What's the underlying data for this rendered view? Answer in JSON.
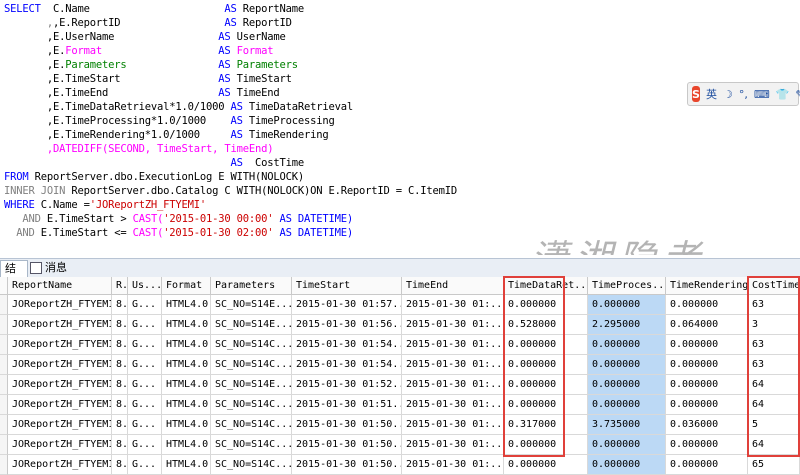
{
  "sql": {
    "l1": {
      "kw": "SELECT",
      "expr": "C.Name",
      "as": "AS",
      "alias": "ReportName"
    },
    "l2": {
      "expr": ",E.ReportID",
      "as": "AS",
      "alias": "ReportID"
    },
    "l3": {
      "expr": ",E.UserName",
      "as": "AS",
      "alias": "UserName"
    },
    "l4": {
      "comma": ",E.",
      "fmt": "Format",
      "as": "AS",
      "alias": "Format"
    },
    "l5": {
      "comma": ",E.",
      "par": "Parameters",
      "as": "AS",
      "alias": "Parameters"
    },
    "l6": {
      "expr": ",E.TimeStart",
      "as": "AS",
      "alias": "TimeStart"
    },
    "l7": {
      "expr": ",E.TimeEnd",
      "as": "AS",
      "alias": "TimeEnd"
    },
    "l8": {
      "expr": ",E.TimeDataRetrieval*1.0/1000",
      "as": "AS",
      "alias": "TimeDataRetrieval"
    },
    "l9": {
      "expr": ",E.TimeProcessing*1.0/1000",
      "as": "AS",
      "alias": "TimeProcessing"
    },
    "l10": {
      "expr": ",E.TimeRendering*1.0/1000",
      "as": "AS",
      "alias": "TimeRendering"
    },
    "l11": {
      "fn": ",DATEDIFF(SECOND, TimeStart, TimeEnd)"
    },
    "l12": {
      "as": "AS",
      "alias": "CostTime"
    },
    "l13": {
      "kw": "FROM",
      "rest": "ReportServer.dbo.ExecutionLog E WITH(NOLOCK)"
    },
    "l14": {
      "kw": "INNER JOIN",
      "rest": "ReportServer.dbo.Catalog C WITH(NOLOCK)ON E.ReportID = C.ItemID"
    },
    "l15": {
      "kw": "WHERE",
      "rest": "C.Name =",
      "str": "'JOReportZH_FTYEMI'"
    },
    "l16": {
      "kw": "AND",
      "rest": "E.TimeStart >",
      "fn": "CAST(",
      "str": "'2015-01-30 00:00'",
      "tail": "AS DATETIME)"
    },
    "l17": {
      "kw": "AND",
      "rest": "E.TimeStart <=",
      "fn": "CAST(",
      "str": "'2015-01-30 02:00'",
      "tail": "AS DATETIME)"
    }
  },
  "ime": {
    "lang": "英",
    "moon": "☽",
    "dots": "°,",
    "kbd": "⌨",
    "shirt": "👕",
    "wrench": "✎"
  },
  "watermark": "潇湘隐者",
  "tabs": {
    "results": "结果",
    "messages": "消息"
  },
  "grid": {
    "headers": [
      "ReportName",
      "R...",
      "Us...",
      "Format",
      "Parameters",
      "TimeStart",
      "TimeEnd",
      "TimeDataRet...",
      "TimeProces...",
      "TimeRendering",
      "CostTime"
    ],
    "rows": [
      [
        "JOReportZH_FTYEMI",
        "8.",
        "G...",
        "HTML4.0",
        "SC_NO=S14E...",
        "2015-01-30 01:57...",
        "2015-01-30 01:...",
        "0.000000",
        "0.000000",
        "0.000000",
        "63"
      ],
      [
        "JOReportZH_FTYEMI",
        "8.",
        "G...",
        "HTML4.0",
        "SC_NO=S14E...",
        "2015-01-30 01:56...",
        "2015-01-30 01:...",
        "0.528000",
        "2.295000",
        "0.064000",
        "3"
      ],
      [
        "JOReportZH_FTYEMI",
        "8.",
        "G...",
        "HTML4.0",
        "SC_NO=S14C...",
        "2015-01-30 01:54...",
        "2015-01-30 01:...",
        "0.000000",
        "0.000000",
        "0.000000",
        "63"
      ],
      [
        "JOReportZH_FTYEMI",
        "8.",
        "G...",
        "HTML4.0",
        "SC_NO=S14C...",
        "2015-01-30 01:54...",
        "2015-01-30 01:...",
        "0.000000",
        "0.000000",
        "0.000000",
        "63"
      ],
      [
        "JOReportZH_FTYEMI",
        "8.",
        "G...",
        "HTML4.0",
        "SC_NO=S14E...",
        "2015-01-30 01:52...",
        "2015-01-30 01:...",
        "0.000000",
        "0.000000",
        "0.000000",
        "64"
      ],
      [
        "JOReportZH_FTYEMI",
        "8.",
        "G...",
        "HTML4.0",
        "SC_NO=S14C...",
        "2015-01-30 01:51...",
        "2015-01-30 01:...",
        "0.000000",
        "0.000000",
        "0.000000",
        "64"
      ],
      [
        "JOReportZH_FTYEMI",
        "8.",
        "G...",
        "HTML4.0",
        "SC_NO=S14C...",
        "2015-01-30 01:50...",
        "2015-01-30 01:...",
        "0.317000",
        "3.735000",
        "0.036000",
        "5"
      ],
      [
        "JOReportZH_FTYEMI",
        "8.",
        "G...",
        "HTML4.0",
        "SC_NO=S14C...",
        "2015-01-30 01:50...",
        "2015-01-30 01:...",
        "0.000000",
        "0.000000",
        "0.000000",
        "64"
      ],
      [
        "JOReportZH_FTYEMI",
        "8.",
        "G...",
        "HTML4.0",
        "SC_NO=S14C...",
        "2015-01-30 01:50...",
        "2015-01-30 01:...",
        "0.000000",
        "0.000000",
        "0.000000",
        "65"
      ]
    ]
  }
}
